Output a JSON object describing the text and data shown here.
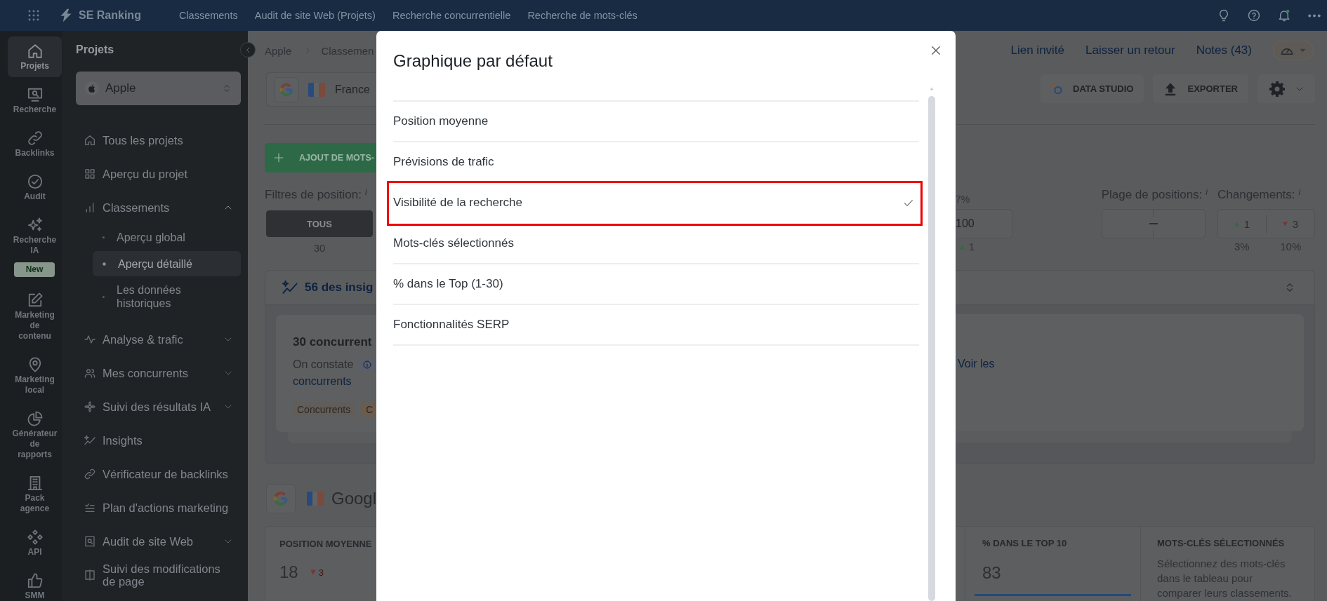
{
  "top_bar": {
    "brand": "SE Ranking",
    "nav": [
      "Classements",
      "Audit de site Web (Projets)",
      "Recherche concurrentielle",
      "Recherche de mots-clés"
    ]
  },
  "icon_rail": [
    {
      "label": "Projets",
      "selected": true
    },
    {
      "label": "Recherche",
      "selected": false
    },
    {
      "label": "Backlinks",
      "selected": false
    },
    {
      "label": "Audit",
      "selected": false
    },
    {
      "label": "Recherche IA",
      "selected": false,
      "badge": "New"
    },
    {
      "label": "Marketing de contenu",
      "selected": false
    },
    {
      "label": "Marketing local",
      "selected": false
    },
    {
      "label": "Générateur de rapports",
      "selected": false
    },
    {
      "label": "Pack agence",
      "selected": false
    },
    {
      "label": "API",
      "selected": false
    },
    {
      "label": "SMM",
      "selected": false
    }
  ],
  "sidebar": {
    "title": "Projets",
    "project": "Apple",
    "items": [
      {
        "label": "Tous les projets",
        "kind": "link",
        "selected": false
      },
      {
        "label": "Aperçu du projet",
        "kind": "link",
        "selected": false
      },
      {
        "label": "Classements",
        "kind": "group",
        "expanded": true,
        "selected": false,
        "children": [
          {
            "label": "Aperçu global",
            "selected": false
          },
          {
            "label": "Aperçu détaillé",
            "selected": true
          },
          {
            "label": "Les données historiques",
            "selected": false
          }
        ]
      },
      {
        "label": "Analyse & trafic",
        "kind": "group",
        "expanded": false,
        "selected": false
      },
      {
        "label": "Mes concurrents",
        "kind": "group",
        "expanded": false,
        "selected": false
      },
      {
        "label": "Suivi des résultats IA",
        "kind": "group",
        "expanded": false,
        "selected": false
      },
      {
        "label": "Insights",
        "kind": "link",
        "selected": false
      },
      {
        "label": "Vérificateur de backlinks",
        "kind": "link",
        "selected": false
      },
      {
        "label": "Plan d'actions marketing",
        "kind": "link",
        "selected": false
      },
      {
        "label": "Audit de site Web",
        "kind": "group",
        "expanded": false,
        "selected": false
      },
      {
        "label": "Suivi des modifications de page",
        "kind": "link",
        "selected": false
      }
    ]
  },
  "breadcrumb": [
    "Apple",
    "Classemen"
  ],
  "search_engine": {
    "location": "France"
  },
  "add_keywords_button": "AJOUT DE MOTS-",
  "header_links": [
    "Lien invité",
    "Laisser un retour",
    "Notes (43)"
  ],
  "toolbar_buttons": [
    "DATA STUDIO",
    "EXPORTER"
  ],
  "position_filters": {
    "label": "Filtres de position:",
    "hint": "i",
    "tabs": [
      {
        "label": "TOUS",
        "count": "30",
        "selected": true
      },
      {
        "label": "100",
        "share": "7%",
        "change": {
          "up": true,
          "value": "1"
        },
        "selected": false
      }
    ]
  },
  "position_range": {
    "label": "Plage de positions:",
    "hint": "i"
  },
  "changes": {
    "label": "Changements:",
    "hint": "i",
    "options": [
      {
        "up": true,
        "value": "1",
        "share": "3%"
      },
      {
        "up": false,
        "value": "3",
        "share": "10%"
      }
    ]
  },
  "insights": {
    "title": "56 des insig",
    "card": {
      "title": "30 concurrent",
      "text": "On constate",
      "link": "concurrents",
      "right_link": "Voir les",
      "tags": [
        {
          "label": "Concurrents",
          "color": "#625d58"
        },
        {
          "label": "C",
          "color": "#6c5c4c"
        }
      ]
    }
  },
  "engine_header": {
    "title": "Googl"
  },
  "stats": [
    {
      "kind": "metric",
      "title": "POSITION MOYENNE",
      "value": "18",
      "change": {
        "up": false,
        "value": "3"
      }
    },
    {
      "kind": "metric",
      "title": "% DANS LE TOP 10",
      "value": "83"
    },
    {
      "kind": "note",
      "title": "MOTS-CLÉS SÉLECTIONNÉS",
      "text": "Sélectionnez des mots-clés dans le tableau pour comparer leurs classements."
    }
  ],
  "dialog": {
    "title": "Graphique par défaut",
    "options": [
      {
        "label": "Position moyenne",
        "selected": false,
        "highlighted": false
      },
      {
        "label": "Prévisions de trafic",
        "selected": false,
        "highlighted": false
      },
      {
        "label": "Visibilité de la recherche",
        "selected": true,
        "highlighted": true
      },
      {
        "label": "Mots-clés sélectionnés",
        "selected": false,
        "highlighted": false
      },
      {
        "label": "% dans le Top (1-30)",
        "selected": false,
        "highlighted": false
      },
      {
        "label": "Fonctionnalités SERP",
        "selected": false,
        "highlighted": false
      }
    ]
  }
}
